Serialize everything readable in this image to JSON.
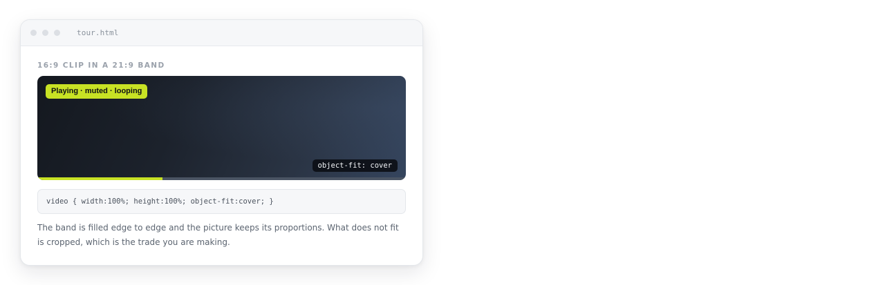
{
  "window": {
    "filename": "tour.html"
  },
  "section": {
    "label": "16:9 clip in a 21:9 band"
  },
  "video": {
    "status_badge": "Playing · muted · looping",
    "fit_badge": "object-fit: cover",
    "progress_fraction": 0.34,
    "colors": {
      "accent": "#c8e224",
      "track": "#4a5463"
    }
  },
  "code": {
    "snippet": "video { width:100%; height:100%; object-fit:cover; }"
  },
  "description": {
    "text": "The band is filled edge to edge and the picture keeps its proportions. What does not fit is cropped, which is the trade you are making."
  }
}
